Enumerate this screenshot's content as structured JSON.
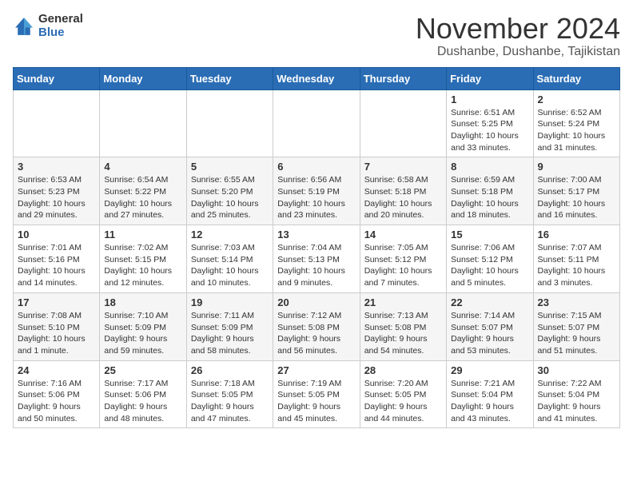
{
  "header": {
    "logo_general": "General",
    "logo_blue": "Blue",
    "month_title": "November 2024",
    "location": "Dushanbe, Dushanbe, Tajikistan"
  },
  "days_of_week": [
    "Sunday",
    "Monday",
    "Tuesday",
    "Wednesday",
    "Thursday",
    "Friday",
    "Saturday"
  ],
  "weeks": [
    [
      {
        "day": "",
        "info": ""
      },
      {
        "day": "",
        "info": ""
      },
      {
        "day": "",
        "info": ""
      },
      {
        "day": "",
        "info": ""
      },
      {
        "day": "",
        "info": ""
      },
      {
        "day": "1",
        "info": "Sunrise: 6:51 AM\nSunset: 5:25 PM\nDaylight: 10 hours and 33 minutes."
      },
      {
        "day": "2",
        "info": "Sunrise: 6:52 AM\nSunset: 5:24 PM\nDaylight: 10 hours and 31 minutes."
      }
    ],
    [
      {
        "day": "3",
        "info": "Sunrise: 6:53 AM\nSunset: 5:23 PM\nDaylight: 10 hours and 29 minutes."
      },
      {
        "day": "4",
        "info": "Sunrise: 6:54 AM\nSunset: 5:22 PM\nDaylight: 10 hours and 27 minutes."
      },
      {
        "day": "5",
        "info": "Sunrise: 6:55 AM\nSunset: 5:20 PM\nDaylight: 10 hours and 25 minutes."
      },
      {
        "day": "6",
        "info": "Sunrise: 6:56 AM\nSunset: 5:19 PM\nDaylight: 10 hours and 23 minutes."
      },
      {
        "day": "7",
        "info": "Sunrise: 6:58 AM\nSunset: 5:18 PM\nDaylight: 10 hours and 20 minutes."
      },
      {
        "day": "8",
        "info": "Sunrise: 6:59 AM\nSunset: 5:18 PM\nDaylight: 10 hours and 18 minutes."
      },
      {
        "day": "9",
        "info": "Sunrise: 7:00 AM\nSunset: 5:17 PM\nDaylight: 10 hours and 16 minutes."
      }
    ],
    [
      {
        "day": "10",
        "info": "Sunrise: 7:01 AM\nSunset: 5:16 PM\nDaylight: 10 hours and 14 minutes."
      },
      {
        "day": "11",
        "info": "Sunrise: 7:02 AM\nSunset: 5:15 PM\nDaylight: 10 hours and 12 minutes."
      },
      {
        "day": "12",
        "info": "Sunrise: 7:03 AM\nSunset: 5:14 PM\nDaylight: 10 hours and 10 minutes."
      },
      {
        "day": "13",
        "info": "Sunrise: 7:04 AM\nSunset: 5:13 PM\nDaylight: 10 hours and 9 minutes."
      },
      {
        "day": "14",
        "info": "Sunrise: 7:05 AM\nSunset: 5:12 PM\nDaylight: 10 hours and 7 minutes."
      },
      {
        "day": "15",
        "info": "Sunrise: 7:06 AM\nSunset: 5:12 PM\nDaylight: 10 hours and 5 minutes."
      },
      {
        "day": "16",
        "info": "Sunrise: 7:07 AM\nSunset: 5:11 PM\nDaylight: 10 hours and 3 minutes."
      }
    ],
    [
      {
        "day": "17",
        "info": "Sunrise: 7:08 AM\nSunset: 5:10 PM\nDaylight: 10 hours and 1 minute."
      },
      {
        "day": "18",
        "info": "Sunrise: 7:10 AM\nSunset: 5:09 PM\nDaylight: 9 hours and 59 minutes."
      },
      {
        "day": "19",
        "info": "Sunrise: 7:11 AM\nSunset: 5:09 PM\nDaylight: 9 hours and 58 minutes."
      },
      {
        "day": "20",
        "info": "Sunrise: 7:12 AM\nSunset: 5:08 PM\nDaylight: 9 hours and 56 minutes."
      },
      {
        "day": "21",
        "info": "Sunrise: 7:13 AM\nSunset: 5:08 PM\nDaylight: 9 hours and 54 minutes."
      },
      {
        "day": "22",
        "info": "Sunrise: 7:14 AM\nSunset: 5:07 PM\nDaylight: 9 hours and 53 minutes."
      },
      {
        "day": "23",
        "info": "Sunrise: 7:15 AM\nSunset: 5:07 PM\nDaylight: 9 hours and 51 minutes."
      }
    ],
    [
      {
        "day": "24",
        "info": "Sunrise: 7:16 AM\nSunset: 5:06 PM\nDaylight: 9 hours and 50 minutes."
      },
      {
        "day": "25",
        "info": "Sunrise: 7:17 AM\nSunset: 5:06 PM\nDaylight: 9 hours and 48 minutes."
      },
      {
        "day": "26",
        "info": "Sunrise: 7:18 AM\nSunset: 5:05 PM\nDaylight: 9 hours and 47 minutes."
      },
      {
        "day": "27",
        "info": "Sunrise: 7:19 AM\nSunset: 5:05 PM\nDaylight: 9 hours and 45 minutes."
      },
      {
        "day": "28",
        "info": "Sunrise: 7:20 AM\nSunset: 5:05 PM\nDaylight: 9 hours and 44 minutes."
      },
      {
        "day": "29",
        "info": "Sunrise: 7:21 AM\nSunset: 5:04 PM\nDaylight: 9 hours and 43 minutes."
      },
      {
        "day": "30",
        "info": "Sunrise: 7:22 AM\nSunset: 5:04 PM\nDaylight: 9 hours and 41 minutes."
      }
    ]
  ]
}
